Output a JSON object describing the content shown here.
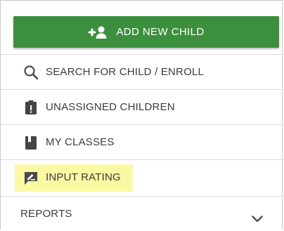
{
  "add_button": {
    "label": "ADD NEW CHILD",
    "icon": "add-person-icon",
    "color": "#3c8f3d"
  },
  "menu": {
    "items": [
      {
        "label": "SEARCH FOR CHILD / ENROLL",
        "icon": "search-icon"
      },
      {
        "label": "UNASSIGNED CHILDREN",
        "icon": "clipboard-alert-icon"
      },
      {
        "label": "MY CLASSES",
        "icon": "book-icon"
      },
      {
        "label": "INPUT RATING",
        "icon": "rating-icon",
        "highlighted": true,
        "highlight_color": "#fbf8a3"
      },
      {
        "label": "REPORTS",
        "icon": "chevron-down-icon"
      }
    ]
  }
}
